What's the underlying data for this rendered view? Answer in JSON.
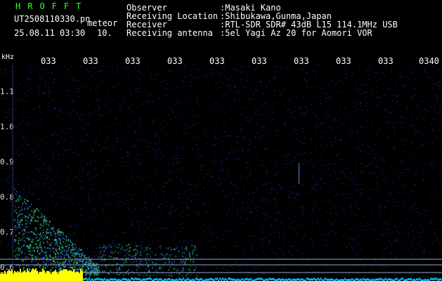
{
  "header": {
    "brand": "HROFFT",
    "filename": "UT2508110330.pn",
    "filetype": "meteor",
    "datetime": "25.08.11 03:30",
    "interval": "10.",
    "rows": [
      {
        "label": "Observer",
        "value": ":Masaki Kano"
      },
      {
        "label": "Receiving Location",
        "value": ":Shibukawa,Gunma,Japan"
      },
      {
        "label": "Receiver",
        "value": ":RTL-SDR SDR# 43dB L15 114.1MHz USB"
      },
      {
        "label": "Receiving antenna",
        "value": ":5el Yagi Az 20 for Aomori VOR"
      }
    ]
  },
  "axis": {
    "unit": "kHz",
    "y_ticks": [
      "1.1",
      "1.0",
      "0.9",
      "0.8",
      "0.7",
      "0.6"
    ],
    "x_ticks": [
      "033",
      "033",
      "033",
      "033",
      "033",
      "033",
      "033",
      "033",
      "033",
      "0340"
    ]
  },
  "colors": {
    "background": "#000000",
    "text": "#ffffff",
    "brand": "#33ff33",
    "noise": "#1a2a90",
    "echo": "#33cc66",
    "strong": "#ffff00",
    "base": "#00ccff"
  }
}
